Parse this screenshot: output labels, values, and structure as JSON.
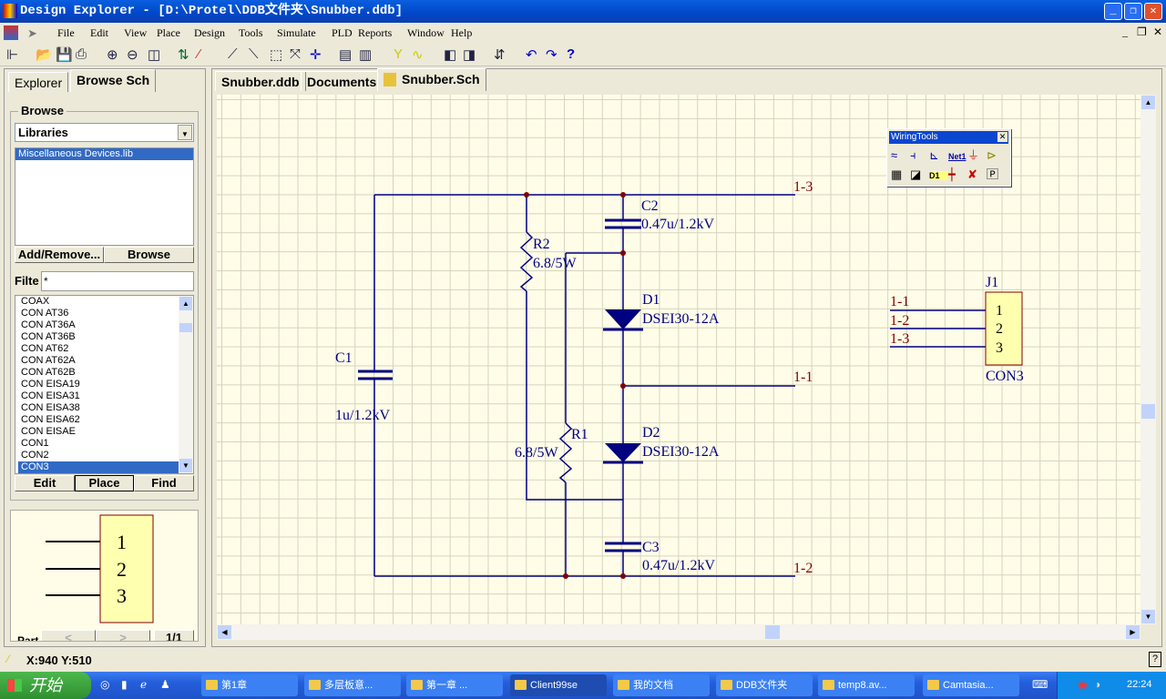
{
  "window": {
    "title": "Design Explorer - [D:\\Protel\\DDB文件夹\\Snubber.ddb]"
  },
  "menu": [
    "File",
    "Edit",
    "View",
    "Place",
    "Design",
    "Tools",
    "Simulate",
    "PLD",
    "Reports",
    "Window",
    "Help"
  ],
  "panel": {
    "tabs": [
      "Explorer",
      "Browse Sch"
    ],
    "browse_label": "Browse",
    "browse_select": "Libraries",
    "libraries": [
      "Miscellaneous Devices.lib"
    ],
    "add_remove": "Add/Remove...",
    "browse_button": "Browse",
    "filter_label": "Filte",
    "filter_value": "*",
    "components": [
      "COAX",
      "CON AT36",
      "CON AT36A",
      "CON AT36B",
      "CON AT62",
      "CON AT62A",
      "CON AT62B",
      "CON EISA19",
      "CON EISA31",
      "CON EISA38",
      "CON EISA62",
      "CON EISAE",
      "CON1",
      "CON2",
      "CON3"
    ],
    "selected": "CON3",
    "edit": "Edit",
    "place": "Place",
    "find": "Find",
    "preview_pins": [
      "1",
      "2",
      "3"
    ],
    "part_label": "Part",
    "page": "1/1"
  },
  "doc_tabs": [
    "Snubber.ddb",
    "Documents",
    "Snubber.Sch"
  ],
  "wiring_tools": {
    "title": "WiringTools",
    "net_label": "Net1",
    "port_label": "D1"
  },
  "schematic": {
    "nets": {
      "n13": "1-3",
      "n11": "1-1",
      "n12": "1-2"
    },
    "C1": {
      "ref": "C1",
      "value": "1u/1.2kV"
    },
    "C2": {
      "ref": "C2",
      "value": "0.47u/1.2kV"
    },
    "C3": {
      "ref": "C3",
      "value": "0.47u/1.2kV"
    },
    "R1": {
      "ref": "R1",
      "value": "6.8/5W"
    },
    "R2": {
      "ref": "R2",
      "value": "6.8/5W"
    },
    "D1": {
      "ref": "D1",
      "value": "DSEI30-12A"
    },
    "D2": {
      "ref": "D2",
      "value": "DSEI30-12A"
    },
    "J1": {
      "ref": "J1",
      "value": "CON3",
      "pins": [
        "1",
        "2",
        "3"
      ],
      "nets": [
        "1-1",
        "1-2",
        "1-3"
      ]
    },
    "wire_color": "#000080",
    "label_color": "#800000",
    "junction_color": "#800000"
  },
  "status": {
    "coords": "X:940 Y:510"
  },
  "taskbar": {
    "start": "开始",
    "items": [
      "第1章",
      "多层板意...",
      "第一章  ...",
      "Client99se",
      "我的文档",
      "DDB文件夹",
      "temp8.av...",
      "Camtasia..."
    ],
    "clock": "22:24"
  }
}
